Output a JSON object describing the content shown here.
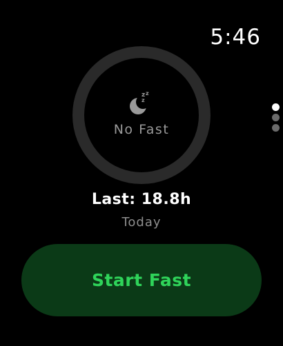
{
  "status_bar": {
    "time": "5:46"
  },
  "fast_ring": {
    "icon": "moon-sleep-icon",
    "status_label": "No Fast",
    "progress": 0
  },
  "last_fast": {
    "label": "Last: 18.8h",
    "day": "Today"
  },
  "page_indicator": {
    "count": 3,
    "active_index": 0
  },
  "actions": {
    "start_label": "Start Fast"
  },
  "colors": {
    "ring_track": "#2a2a2a",
    "button_bg": "#0b3a17",
    "button_text": "#2fd45a",
    "secondary_text": "#8e8e8e"
  }
}
